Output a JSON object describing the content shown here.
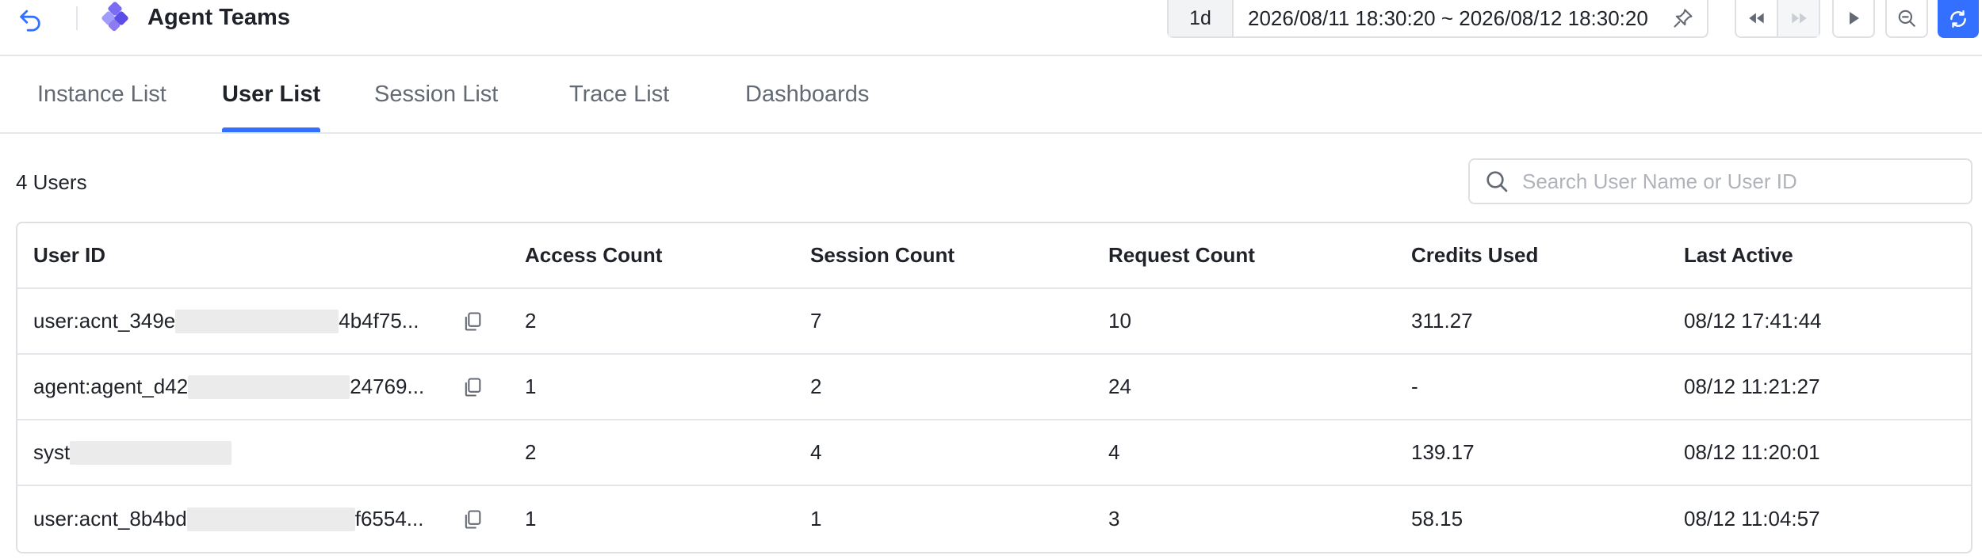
{
  "header": {
    "title": "Agent Teams",
    "time_range": {
      "quick": "1d",
      "text": "2026/08/11 18:30:20 ~ 2026/08/12 18:30:20"
    }
  },
  "tabs": [
    {
      "label": "Instance List",
      "active": false
    },
    {
      "label": "User List",
      "active": true
    },
    {
      "label": "Session List",
      "active": false
    },
    {
      "label": "Trace List",
      "active": false
    },
    {
      "label": "Dashboards",
      "active": false
    }
  ],
  "toolbar": {
    "count_label": "4 Users",
    "search_placeholder": "Search User Name or User ID"
  },
  "table": {
    "columns": [
      "User ID",
      "Access Count",
      "Session Count",
      "Request Count",
      "Credits Used",
      "Last Active"
    ],
    "rows": [
      {
        "uid_prefix": "user:acnt_349e",
        "uid_suffix": "4b4f75...",
        "access": "2",
        "session": "7",
        "request": "10",
        "credits": "311.27",
        "last_active": "08/12 17:41:44"
      },
      {
        "uid_prefix": "agent:agent_d42",
        "uid_suffix": "24769...",
        "access": "1",
        "session": "2",
        "request": "24",
        "credits": "-",
        "last_active": "08/12 11:21:27"
      },
      {
        "uid_prefix": "syst",
        "uid_suffix": "",
        "access": "2",
        "session": "4",
        "request": "4",
        "credits": "139.17",
        "last_active": "08/12 11:20:01"
      },
      {
        "uid_prefix": "user:acnt_8b4bd",
        "uid_suffix": "f6554...",
        "access": "1",
        "session": "1",
        "request": "3",
        "credits": "58.15",
        "last_active": "08/12 11:04:57"
      }
    ]
  },
  "colors": {
    "accent": "#3370ff",
    "text": "#1f2329",
    "muted": "#646a73",
    "border": "#dee0e3"
  }
}
